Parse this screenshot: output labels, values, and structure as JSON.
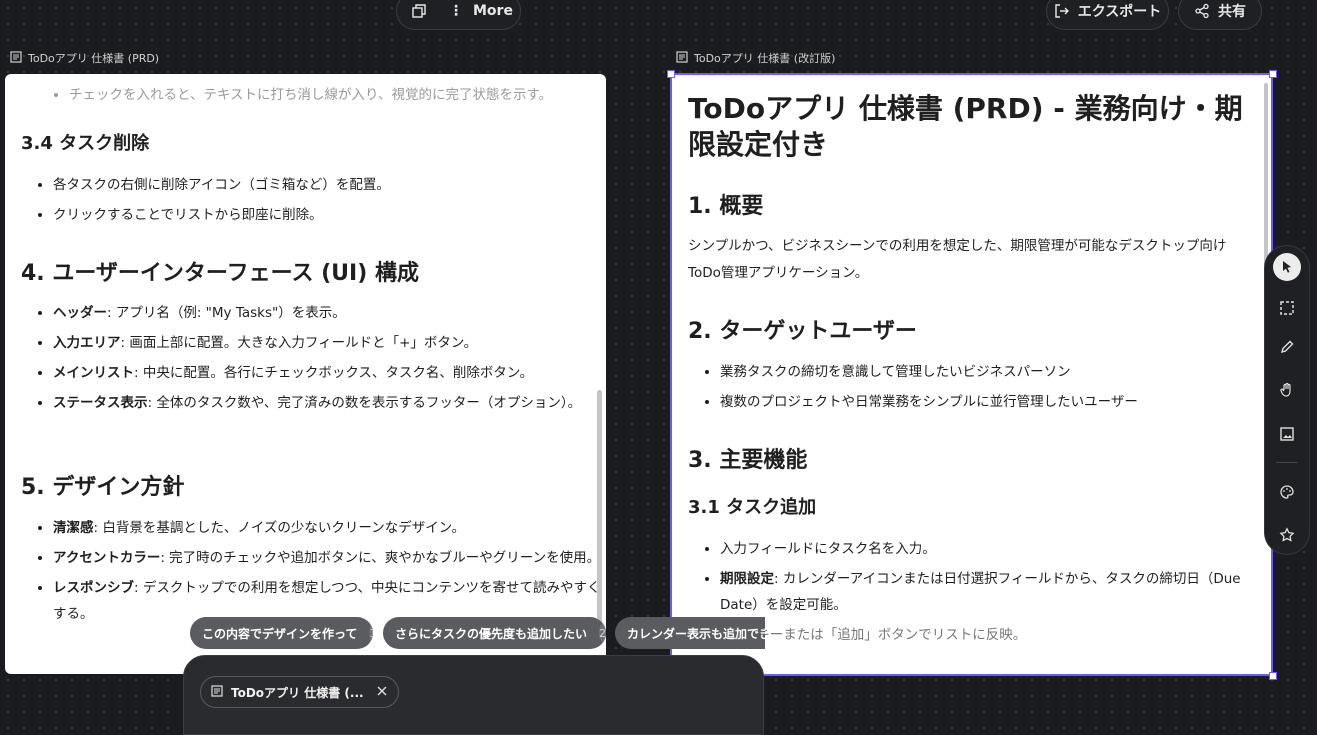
{
  "topbar": {
    "more_label": "More",
    "export_label": "エクスポート",
    "share_label": "共有"
  },
  "left_frame": {
    "title": "ToDoアプリ 仕様書 (PRD)",
    "faded_item": "チェックを入れると、テキストに打ち消し線が入り、視覚的に完了状態を示す。",
    "s34_heading": "3.4 タスク削除",
    "s34_items": [
      "各タスクの右側に削除アイコン（ゴミ箱など）を配置。",
      "クリックすることでリストから即座に削除。"
    ],
    "s4_heading": "4. ユーザーインターフェース (UI) 構成",
    "s4_items": [
      {
        "label": "ヘッダー",
        "text": ": アプリ名（例: \"My Tasks\"）を表示。"
      },
      {
        "label": "入力エリア",
        "text": ": 画面上部に配置。大きな入力フィールドと「+」ボタン。"
      },
      {
        "label": "メインリスト",
        "text": ": 中央に配置。各行にチェックボックス、タスク名、削除ボタン。"
      },
      {
        "label": "ステータス表示",
        "text": ": 全体のタスク数や、完了済みの数を表示するフッター（オプション）。"
      }
    ],
    "s5_heading": "5. デザイン方針",
    "s5_items": [
      {
        "label": "清潔感",
        "text": ": 白背景を基調とした、ノイズの少ないクリーンなデザイン。"
      },
      {
        "label": "アクセントカラー",
        "text": ": 完了時のチェックや追加ボタンに、爽やかなブルーやグリーンを使用。"
      },
      {
        "label": "レスポンシブ",
        "text": ": デスクトップでの利用を想定しつつ、中央にコンテンツを寄せて読みやすくする。"
      }
    ]
  },
  "right_frame": {
    "title": "ToDoアプリ 仕様書 (改訂版)",
    "doc_title": "ToDoアプリ 仕様書 (PRD) - 業務向け・期限設定付き",
    "s1_heading": "1. 概要",
    "s1_text": "シンプルかつ、ビジネスシーンでの利用を想定した、期限管理が可能なデスクトップ向けToDo管理アプリケーション。",
    "s2_heading": "2. ターゲットユーザー",
    "s2_items": [
      "業務タスクの締切を意識して管理したいビジネスパーソン",
      "複数のプロジェクトや日常業務をシンプルに並行管理したいユーザー"
    ],
    "s3_heading": "3. 主要機能",
    "s31_heading": "3.1 タスク追加",
    "s31_item1": "入力フィールドにタスク名を入力。",
    "s31_item2_label": "期限設定",
    "s31_item2_text": ": カレンダーアイコンまたは日付選択フィールドから、タスクの締切日（Due Date）を設定可能。",
    "s31_item3": "Enterキーまたは「追加」ボタンでリストに反映。"
  },
  "suggestions": [
    {
      "label": "この内容でデザインを作って",
      "num": "1"
    },
    {
      "label": "さらにタスクの優先度も追加したい",
      "num": "2"
    },
    {
      "label": "カレンダー表示も追加できる",
      "num": ""
    }
  ],
  "attachment": {
    "label": "ToDoアプリ 仕様書 (..."
  },
  "tools": [
    "cursor-icon",
    "select-area-icon",
    "pencil-icon",
    "hand-icon",
    "image-icon",
    "palette-icon",
    "star-icon"
  ],
  "colors": {
    "selection": "#6b5cff",
    "canvas": "#1b1c1f"
  }
}
